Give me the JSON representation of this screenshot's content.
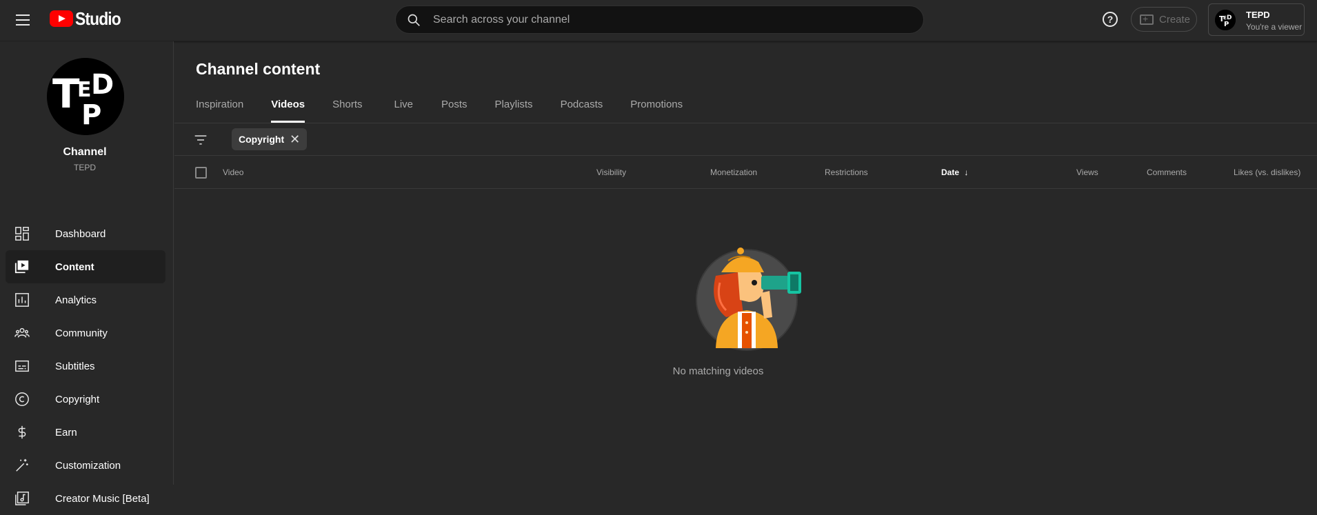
{
  "app": {
    "title": "Studio",
    "search_placeholder": "Search across your channel",
    "create_label": "Create",
    "help_label": "?"
  },
  "account": {
    "name": "TEPD",
    "role": "You're a viewer",
    "avatar_text": "TEPD"
  },
  "channel": {
    "title": "Channel",
    "handle": "TEPD"
  },
  "sidebar": {
    "items": [
      {
        "label": "Dashboard",
        "icon": "dashboard-icon"
      },
      {
        "label": "Content",
        "icon": "content-icon",
        "active": true
      },
      {
        "label": "Analytics",
        "icon": "analytics-icon"
      },
      {
        "label": "Community",
        "icon": "community-icon"
      },
      {
        "label": "Subtitles",
        "icon": "subtitles-icon"
      },
      {
        "label": "Copyright",
        "icon": "copyright-icon"
      },
      {
        "label": "Earn",
        "icon": "earn-icon"
      },
      {
        "label": "Customization",
        "icon": "customization-icon"
      },
      {
        "label": "Creator Music [Beta]",
        "icon": "music-icon"
      }
    ]
  },
  "main": {
    "title": "Channel content",
    "tabs": [
      {
        "label": "Inspiration"
      },
      {
        "label": "Videos",
        "active": true
      },
      {
        "label": "Shorts"
      },
      {
        "label": "Live"
      },
      {
        "label": "Posts"
      },
      {
        "label": "Playlists"
      },
      {
        "label": "Podcasts"
      },
      {
        "label": "Promotions"
      }
    ],
    "filter_chip": "Copyright",
    "columns": {
      "video": "Video",
      "visibility": "Visibility",
      "monetization": "Monetization",
      "restrictions": "Restrictions",
      "date": "Date",
      "views": "Views",
      "comments": "Comments",
      "likes": "Likes (vs. dislikes)"
    },
    "empty_message": "No matching videos"
  },
  "colors": {
    "background": "#282828",
    "brand_red": "#ff0000",
    "text_secondary": "#aaaaaa"
  }
}
